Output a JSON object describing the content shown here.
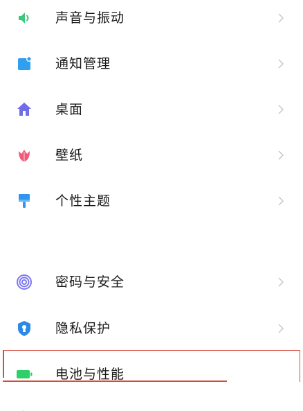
{
  "settings": {
    "items": [
      {
        "label": "声音与振动",
        "icon": "speaker-icon",
        "color": "#3ec67a",
        "chevron": true
      },
      {
        "label": "通知管理",
        "icon": "notification-icon",
        "color": "#2f9ff0",
        "chevron": true
      },
      {
        "label": "桌面",
        "icon": "home-icon",
        "color": "#6f6de8",
        "chevron": true
      },
      {
        "label": "壁纸",
        "icon": "tulip-icon",
        "color": "#ef5b78",
        "chevron": true
      },
      {
        "label": "个性主题",
        "icon": "brush-icon",
        "color": "#2f95ef",
        "chevron": true
      },
      {
        "label": "密码与安全",
        "icon": "fingerprint-icon",
        "color": "#7c77f0",
        "chevron": true
      },
      {
        "label": "隐私保护",
        "icon": "shield-icon",
        "color": "#2a8ae6",
        "chevron": true
      },
      {
        "label": "电池与性能",
        "icon": "battery-icon",
        "color": "#2fcf6a",
        "chevron": false
      }
    ]
  },
  "colors": {
    "text": "#1a1a1a",
    "chevron": "#c4c4c4",
    "highlight": "#d84a3f"
  }
}
